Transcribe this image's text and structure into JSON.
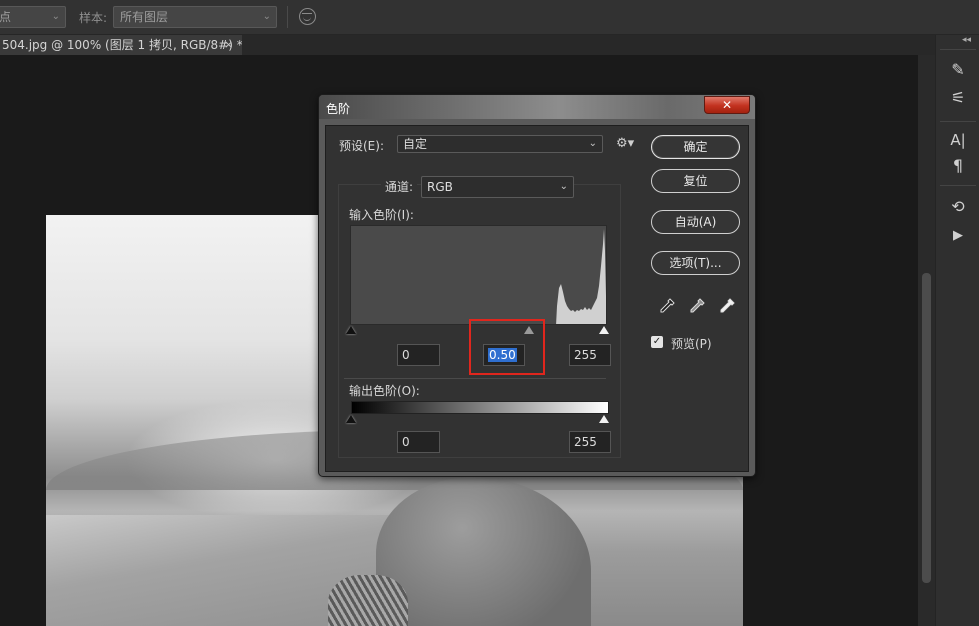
{
  "options_bar": {
    "left_select_value": "点",
    "sample_label": "样本:",
    "sample_select_value": "所有图层"
  },
  "document_tab": {
    "title": "504.jpg @ 100% (图层 1 拷贝, RGB/8#) *",
    "close_glyph": "×"
  },
  "right_panel": {
    "collapse_glyph": "◂◂",
    "tools": [
      {
        "name": "brush-presets-icon",
        "glyph": "✎"
      },
      {
        "name": "adjustments-icon",
        "glyph": "⚟"
      },
      {
        "name": "character-icon",
        "glyph": "A|"
      },
      {
        "name": "paragraph-icon",
        "glyph": "¶"
      },
      {
        "name": "history-icon",
        "glyph": "⟲"
      },
      {
        "name": "actions-play-icon",
        "glyph": "▶"
      }
    ]
  },
  "dialog": {
    "title": "色阶",
    "close_glyph": "✕",
    "preset_label": "预设(E):",
    "preset_value": "自定",
    "channel_label": "通道:",
    "channel_value": "RGB",
    "input_levels_label": "输入色阶(I):",
    "input_black": "0",
    "input_gamma": "0.50",
    "input_white": "255",
    "output_levels_label": "输出色阶(O):",
    "output_black": "0",
    "output_white": "255",
    "buttons": {
      "ok": "确定",
      "reset": "复位",
      "auto": "自动(A)",
      "options": "选项(T)..."
    },
    "preview_label": "预览(P)",
    "preview_checked": true
  },
  "colors": {
    "highlight_box": "#e0261d",
    "selection": "#2f6fd0",
    "close_button": "#c2311f"
  }
}
